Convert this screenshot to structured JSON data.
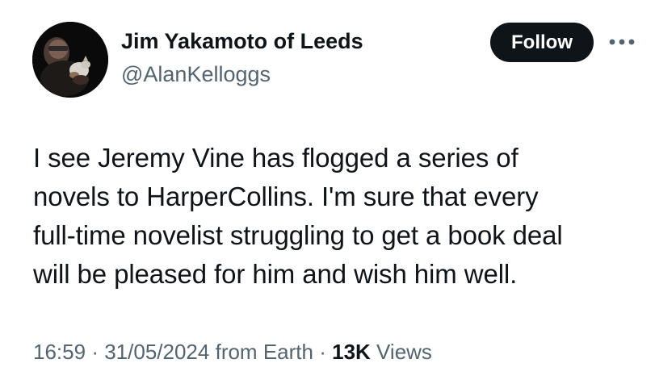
{
  "author": {
    "display_name": "Jim Yakamoto of Leeds",
    "handle": "@AlanKelloggs"
  },
  "actions": {
    "follow_label": "Follow",
    "more_icon": "more-horizontal-icon"
  },
  "tweet": {
    "lines": [
      "I see Jeremy Vine has flogged a series of",
      "novels to HarperCollins. I'm sure that every",
      "full-time novelist struggling to get a book deal",
      "will be pleased for him and wish him well."
    ]
  },
  "meta": {
    "time": "16:59",
    "separator": "·",
    "date": "31/05/2024",
    "source": "from Earth",
    "views_count": "13K",
    "views_label": "Views"
  },
  "colors": {
    "text_primary": "#0f1419",
    "text_secondary": "#536471",
    "follow_bg": "#0f1419",
    "follow_text": "#ffffff",
    "background": "#ffffff"
  }
}
